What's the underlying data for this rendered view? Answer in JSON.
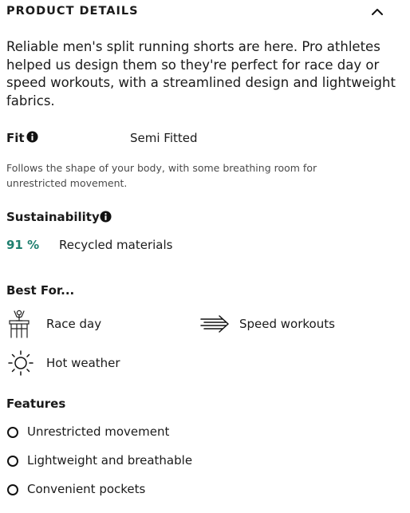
{
  "header": {
    "title": "PRODUCT DETAILS",
    "toggle_icon": "chevron-up-icon"
  },
  "description": "Reliable men's split running shorts are here. Pro athletes helped us design them so they're perfect for race day or speed workouts, with a streamlined design and lightweight fabrics.",
  "fit": {
    "label": "Fit",
    "info_icon": "info-icon",
    "value": "Semi Fitted",
    "description": "Follows the shape of your body, with some breathing room for unrestricted movement."
  },
  "sustainability": {
    "label": "Sustainability",
    "info_icon": "info-icon",
    "percent": "91 %",
    "text": "Recycled materials",
    "accent_color": "#1e7f6f"
  },
  "best_for": {
    "label": "Best For...",
    "items": [
      {
        "label": "Race day",
        "icon": "race-day-icon"
      },
      {
        "label": "Speed workouts",
        "icon": "speed-arrow-icon"
      },
      {
        "label": "Hot weather",
        "icon": "sun-icon"
      }
    ]
  },
  "features": {
    "label": "Features",
    "items": [
      "Unrestricted movement",
      "Lightweight and breathable",
      "Convenient pockets"
    ]
  }
}
